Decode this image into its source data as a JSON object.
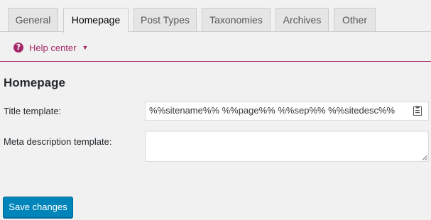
{
  "tabs": [
    {
      "label": "General",
      "active": false
    },
    {
      "label": "Homepage",
      "active": true
    },
    {
      "label": "Post Types",
      "active": false
    },
    {
      "label": "Taxonomies",
      "active": false
    },
    {
      "label": "Archives",
      "active": false
    },
    {
      "label": "Other",
      "active": false
    }
  ],
  "help": {
    "icon": "question-mark-icon",
    "label": "Help center",
    "caret": "▼"
  },
  "section": {
    "title": "Homepage",
    "title_template": {
      "label": "Title template:",
      "value": "%%sitename%% %%page%% %%sep%% %%sitedesc%%",
      "icon": "snippet-variables-icon"
    },
    "meta_description_template": {
      "label": "Meta description template:",
      "value": ""
    }
  },
  "save_button": {
    "label": "Save changes"
  },
  "colors": {
    "accent": "#a4286a",
    "primary_button": "#0085ba",
    "background": "#f1f1f1"
  }
}
